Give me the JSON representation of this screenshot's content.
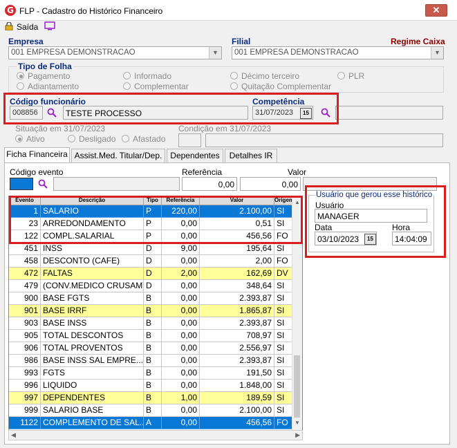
{
  "window": {
    "title": "FLP - Cadastro do Histórico Financeiro",
    "close": "✕"
  },
  "toolbar": {
    "saida_label": "Saída"
  },
  "empresa": {
    "label": "Empresa",
    "value": "001 EMPRESA DEMONSTRACAO"
  },
  "filial": {
    "label": "Filial",
    "value": "001 EMPRESA DEMONSTRACAO"
  },
  "regime": {
    "label": "Regime Caixa"
  },
  "tipo_folha": {
    "label": "Tipo de Folha",
    "options": [
      "Pagamento",
      "Informado",
      "Décimo terceiro",
      "PLR",
      "Adiantamento",
      "Complementar",
      "Quitação Complementar"
    ],
    "selected": "Pagamento"
  },
  "funcionario": {
    "label": "Código funcionário",
    "code": "008856",
    "name": "TESTE PROCESSO"
  },
  "competencia": {
    "label": "Competência",
    "value": "31/07/2023",
    "btn": "15"
  },
  "situacao": {
    "label": "Situação em 31/07/2023",
    "options": [
      "Ativo",
      "Desligado",
      "Afastado"
    ],
    "selected": "Ativo"
  },
  "condicao": {
    "label": "Condição em 31/07/2023"
  },
  "tabs": [
    "Ficha Financeira",
    "Assist.Med. Titular/Dep.",
    "Dependentes",
    "Detalhes IR"
  ],
  "evento_form": {
    "codigo_label": "Código evento",
    "referencia_label": "Referência",
    "referencia_value": "0,00",
    "valor_label": "Valor",
    "valor_value": "0,00"
  },
  "grid": {
    "headers": [
      "Evento",
      "Descrição",
      "Tipo",
      "Referência",
      "Valor",
      "Origem"
    ],
    "rows": [
      {
        "evento": "1",
        "descricao": "SALARIO",
        "tipo": "P",
        "referencia": "220,00",
        "valor": "2.100,00",
        "origem": "SI",
        "style": "sel"
      },
      {
        "evento": "23",
        "descricao": "ARREDONDAMENTO",
        "tipo": "P",
        "referencia": "0,00",
        "valor": "0,51",
        "origem": "SI",
        "style": ""
      },
      {
        "evento": "122",
        "descricao": "COMPL.SALARIAL",
        "tipo": "P",
        "referencia": "0,00",
        "valor": "456,56",
        "origem": "FO",
        "style": ""
      },
      {
        "evento": "451",
        "descricao": "INSS",
        "tipo": "D",
        "referencia": "9,00",
        "valor": "195,64",
        "origem": "SI",
        "style": ""
      },
      {
        "evento": "458",
        "descricao": "DESCONTO (CAFE)",
        "tipo": "D",
        "referencia": "0,00",
        "valor": "2,00",
        "origem": "FO",
        "style": ""
      },
      {
        "evento": "472",
        "descricao": "FALTAS",
        "tipo": "D",
        "referencia": "2,00",
        "valor": "162,69",
        "origem": "DV",
        "style": "yellow"
      },
      {
        "evento": "479",
        "descricao": "(CONV.MEDICO CRUSAM)",
        "tipo": "D",
        "referencia": "0,00",
        "valor": "348,64",
        "origem": "SI",
        "style": ""
      },
      {
        "evento": "900",
        "descricao": "BASE FGTS",
        "tipo": "B",
        "referencia": "0,00",
        "valor": "2.393,87",
        "origem": "SI",
        "style": ""
      },
      {
        "evento": "901",
        "descricao": "BASE IRRF",
        "tipo": "B",
        "referencia": "0,00",
        "valor": "1.865,87",
        "origem": "SI",
        "style": "yellow"
      },
      {
        "evento": "903",
        "descricao": "BASE INSS",
        "tipo": "B",
        "referencia": "0,00",
        "valor": "2.393,87",
        "origem": "SI",
        "style": ""
      },
      {
        "evento": "905",
        "descricao": "TOTAL DESCONTOS",
        "tipo": "B",
        "referencia": "0,00",
        "valor": "708,97",
        "origem": "SI",
        "style": ""
      },
      {
        "evento": "906",
        "descricao": "TOTAL PROVENTOS",
        "tipo": "B",
        "referencia": "0,00",
        "valor": "2.556,97",
        "origem": "SI",
        "style": ""
      },
      {
        "evento": "986",
        "descricao": "BASE INSS SAL EMPRE...",
        "tipo": "B",
        "referencia": "0,00",
        "valor": "2.393,87",
        "origem": "SI",
        "style": ""
      },
      {
        "evento": "993",
        "descricao": "FGTS",
        "tipo": "B",
        "referencia": "0,00",
        "valor": "191,50",
        "origem": "SI",
        "style": ""
      },
      {
        "evento": "996",
        "descricao": "LIQUIDO",
        "tipo": "B",
        "referencia": "0,00",
        "valor": "1.848,00",
        "origem": "SI",
        "style": ""
      },
      {
        "evento": "997",
        "descricao": "DEPENDENTES",
        "tipo": "B",
        "referencia": "1,00",
        "valor": "189,59",
        "origem": "SI",
        "style": "yellow"
      },
      {
        "evento": "999",
        "descricao": "SALARIO BASE",
        "tipo": "B",
        "referencia": "0,00",
        "valor": "2.100,00",
        "origem": "SI",
        "style": ""
      },
      {
        "evento": "1122",
        "descricao": "COMPLEMENTO DE SAL...",
        "tipo": "A",
        "referencia": "0,00",
        "valor": "456,56",
        "origem": "FO",
        "style": "sel"
      }
    ]
  },
  "usuario_box": {
    "title": "Usuário que gerou esse histórico",
    "usuario_label": "Usuário",
    "usuario_value": "MANAGER",
    "data_label": "Data",
    "data_value": "03/10/2023",
    "data_btn": "15",
    "hora_label": "Hora",
    "hora_value": "14:04:09"
  },
  "colors": {
    "selection": "#0a78d7",
    "highlight": "#ffff99",
    "annotation": "#d81e1e",
    "label_blue": "#0a2a7a"
  }
}
